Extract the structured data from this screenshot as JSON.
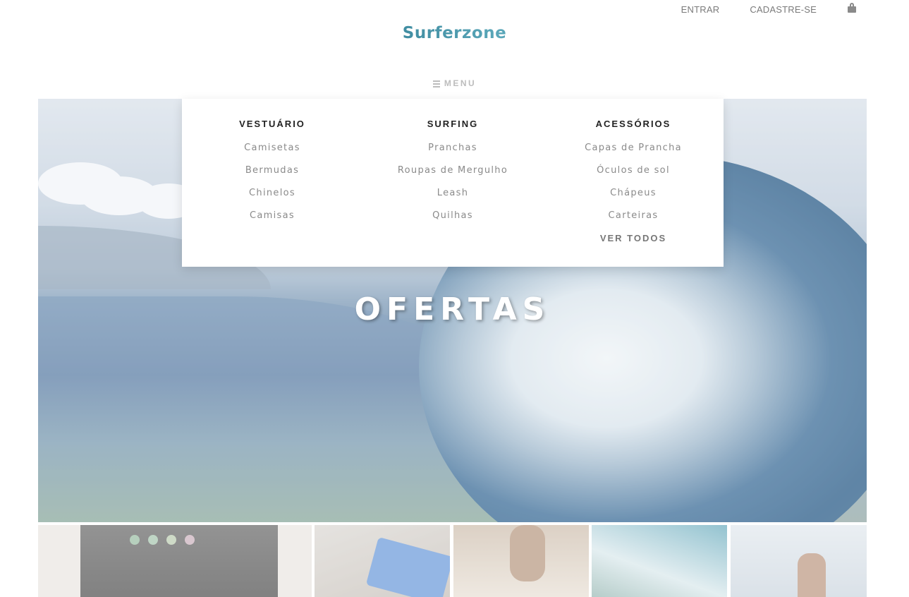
{
  "header": {
    "login_label": "ENTRAR",
    "signup_label": "CADASTRE-SE",
    "cart_icon": "shopping-bag-icon",
    "logo_text": "Surferzone",
    "menu_label": "MENU",
    "menu_icon": "hamburger-icon"
  },
  "mega_menu": {
    "columns": [
      {
        "title": "VESTUÁRIO",
        "items": [
          "Camisetas",
          "Bermudas",
          "Chinelos",
          "Camisas"
        ]
      },
      {
        "title": "SURFING",
        "items": [
          "Pranchas",
          "Roupas de Mergulho",
          "Leash",
          "Quilhas"
        ]
      },
      {
        "title": "ACESSÓRIOS",
        "items": [
          "Capas de Prancha",
          "Óculos de sol",
          "Chápeus",
          "Carteiras"
        ],
        "see_all": "VER TODOS"
      }
    ]
  },
  "hero": {
    "title": "OFERTAS"
  },
  "colors": {
    "accent": "#2a7b93",
    "menu_text": "#8a8a8a",
    "heading": "#222222"
  }
}
